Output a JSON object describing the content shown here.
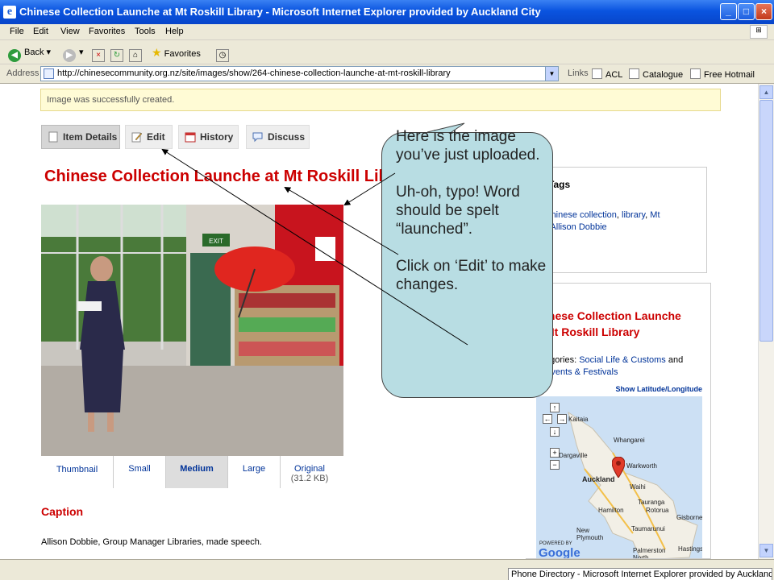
{
  "window": {
    "title": "Chinese Collection Launche at Mt Roskill Library - Microsoft Internet Explorer provided by Auckland City",
    "minimize": "_",
    "maximize": "□",
    "close": "×"
  },
  "menu": [
    "File",
    "Edit",
    "View",
    "Favorites",
    "Tools",
    "Help"
  ],
  "toolbar": {
    "back": "Back",
    "favorites": "Favorites"
  },
  "address": {
    "label": "Address",
    "url": "http://chinesecommunity.org.nz/site/images/show/264-chinese-collection-launche-at-mt-roskill-library",
    "links_label": "Links",
    "links": [
      "ACL",
      "Catalogue",
      "Free Hotmail"
    ]
  },
  "page": {
    "notice": "Image was successfully created.",
    "tabs": [
      {
        "label": "Item Details"
      },
      {
        "label": "Edit"
      },
      {
        "label": "History"
      },
      {
        "label": "Discuss"
      }
    ],
    "title": "Chinese Collection Launche at Mt Roskill Library",
    "sizes": [
      "Thumbnail",
      "Small",
      "Medium",
      "Large",
      "Original"
    ],
    "original_size": "(31.2 KB)",
    "caption_heading": "Caption",
    "caption_text": "Allison Dobbie, Group Manager Libraries, made speech.",
    "sign_text": "EXIT"
  },
  "sidebar": {
    "tags_heading": "Tags",
    "tags_prefix": "s: ",
    "tags_part1": "Chinese collection",
    "tags_sep1": ", ",
    "tags_part2": "library",
    "tags_sep2": ", ",
    "tags_part3": "Mt",
    "tags_part3b": "kill",
    "tags_sep3": ", ",
    "tags_part4": "Allison Dobbie",
    "info_title": "inese Collection Launche\nMt Roskill Library",
    "categories_prefix": "egories: ",
    "cat1": "Social Life & Customs",
    "cat_and": " and",
    "cat2": "Events & Festivals",
    "geo_link": "Show Latitude/Longitude",
    "map_cities": [
      "Kaitaia",
      "Whangarei",
      "Dargaville",
      "Warkworth",
      "Auckland",
      "Waihi",
      "Tauranga",
      "Hamilton",
      "Rotorua",
      "Gisborne",
      "New Plymouth",
      "Taumarunui",
      "Hastings",
      "Palmerston North"
    ],
    "map_powered": "POWERED BY",
    "map_brand": "Google"
  },
  "callout": {
    "text": "Here is the image you’ve just uploaded.\n\nUh-oh, typo! Word should be spelt “launched”.\n\nClick on ‘Edit’ to make changes."
  },
  "status": {
    "task": "Phone Directory - Microsoft Internet Explorer provided by Auckland City"
  },
  "colors": {
    "title_red": "#cc0000",
    "link_blue": "#003399",
    "callout_fill": "#b8dde3",
    "notice_bg": "#fffbd5"
  }
}
